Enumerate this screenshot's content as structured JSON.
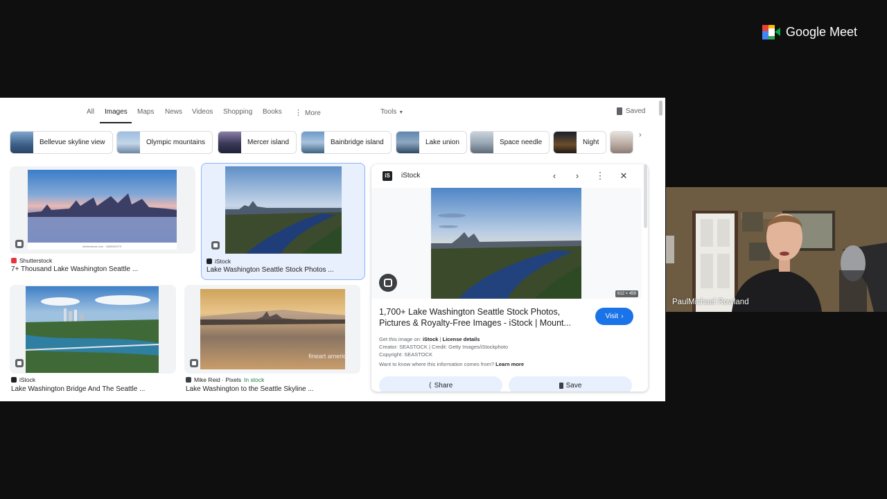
{
  "search_tabs": {
    "items": [
      "All",
      "Images",
      "Maps",
      "News",
      "Videos",
      "Shopping",
      "Books"
    ],
    "more_label": "More",
    "tools_label": "Tools",
    "saved_label": "Saved",
    "active": "Images"
  },
  "chips": [
    {
      "label": "Bellevue skyline view"
    },
    {
      "label": "Olympic mountains"
    },
    {
      "label": "Mercer island"
    },
    {
      "label": "Bainbridge island"
    },
    {
      "label": "Lake union"
    },
    {
      "label": "Space needle"
    },
    {
      "label": "Night"
    }
  ],
  "results": [
    {
      "source": "Shutterstock",
      "title": "7+ Thousand Lake Washington Seattle ...",
      "watermark": "shutterstock.com · 1868092279"
    },
    {
      "source": "iStock",
      "title": "Lake Washington Seattle Stock Photos ..."
    },
    {
      "source": "iStock",
      "title": "Lake Washington Bridge And The Seattle ..."
    },
    {
      "source": "Mike Reid · Pixels",
      "in_stock": "In stock",
      "title": "Lake Washington to the Seattle Skyline ...",
      "watermark": "fineart america"
    }
  ],
  "preview": {
    "site": "iStock",
    "dimensions": "612 × 459",
    "title": "1,700+ Lake Washington Seattle Stock Photos, Pictures & Royalty-Free Images - iStock | Mount...",
    "visit_label": "Visit",
    "get_image_prefix": "Get this image on:",
    "get_image_site": "iStock",
    "license_details": "License details",
    "creator": "Creator: SEASTOCK | Credit: Getty Images/iStockphoto",
    "copyright": "Copyright: SEASTOCK",
    "info_question": "Want to know where this information comes from?",
    "learn_more": "Learn more",
    "share_label": "Share",
    "save_label": "Save"
  },
  "meet": {
    "app_name": "Google Meet",
    "participant_name": "PaulMichael Rowland"
  }
}
